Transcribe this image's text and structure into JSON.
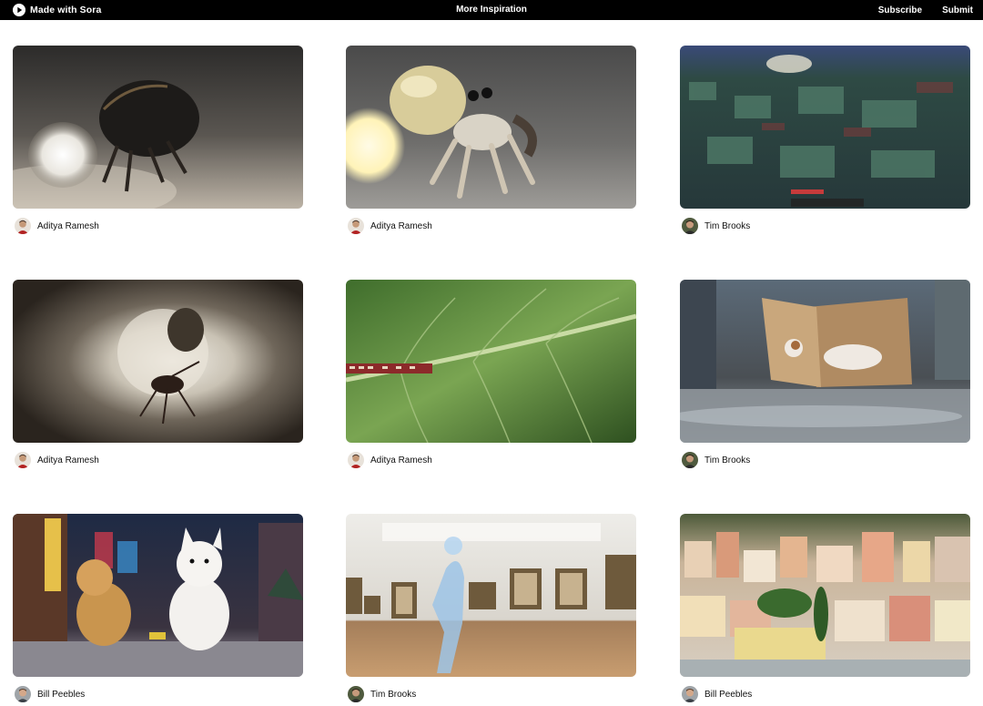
{
  "header": {
    "brand": "Made with Sora",
    "center_link": "More Inspiration",
    "subscribe": "Subscribe",
    "submit": "Submit"
  },
  "icons": {
    "brand": "play-circle-icon"
  },
  "videos": [
    {
      "author": "Aditya Ramesh",
      "thumb": "lightbulb-hermit-crab-dark"
    },
    {
      "author": "Aditya Ramesh",
      "thumb": "lightbulb-hermit-crab-light"
    },
    {
      "author": "Tim Brooks",
      "thumb": "minecraft-landscape"
    },
    {
      "author": "Aditya Ramesh",
      "thumb": "ant-in-tunnel"
    },
    {
      "author": "Aditya Ramesh",
      "thumb": "train-on-leaf"
    },
    {
      "author": "Tim Brooks",
      "thumb": "cat-in-alley"
    },
    {
      "author": "Bill Peebles",
      "thumb": "dogs-in-snowy-city"
    },
    {
      "author": "Tim Brooks",
      "thumb": "glass-figure-in-gallery"
    },
    {
      "author": "Bill Peebles",
      "thumb": "coastal-village"
    }
  ],
  "colors": {
    "topbar": "#000000",
    "background": "#ffffff"
  }
}
